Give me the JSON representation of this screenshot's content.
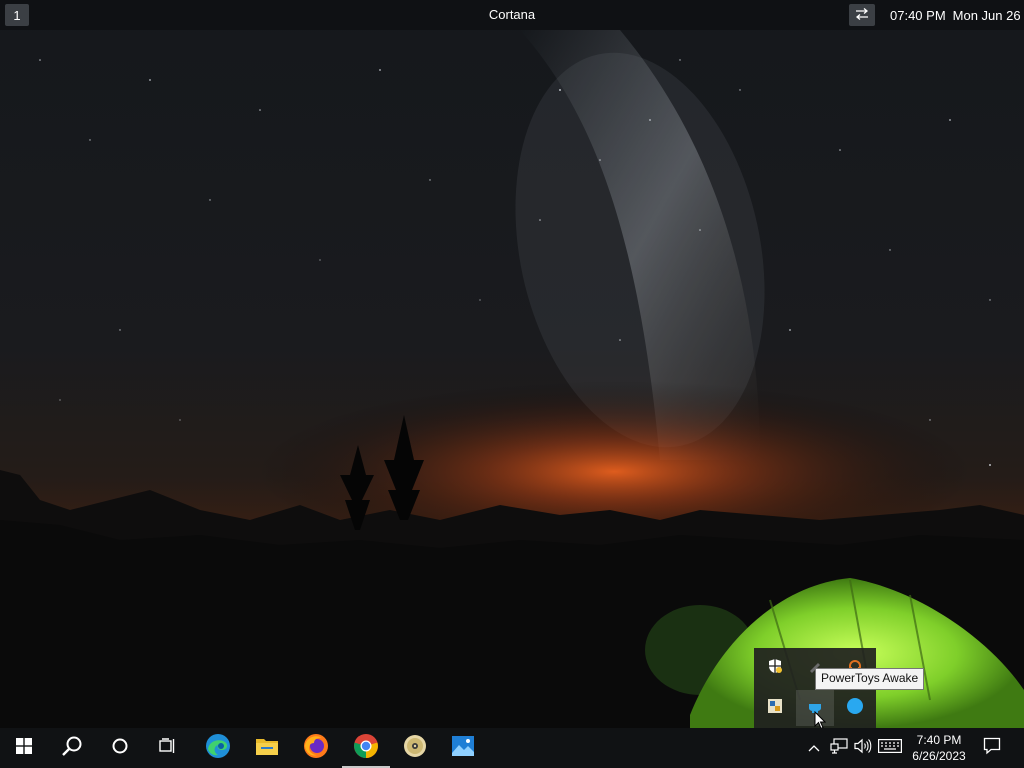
{
  "topbar": {
    "workspace": "1",
    "title": "Cortana",
    "time": "07:40 PM",
    "date": "Mon Jun 26"
  },
  "tray_popup": {
    "tooltip": "PowerToys Awake",
    "icons": [
      "security-shield-icon",
      "pen-icon",
      "headset-icon",
      "app-icon",
      "powertoys-awake-icon",
      "blue-circle-icon"
    ]
  },
  "taskbar": {
    "pinned": [
      "start-icon",
      "search-icon",
      "cortana-icon",
      "task-view-icon",
      "edge-icon",
      "file-explorer-icon",
      "firefox-icon",
      "chrome-icon",
      "disc-icon",
      "photos-icon"
    ],
    "active_app": "chrome-icon",
    "clock_time": "7:40 PM",
    "clock_date": "6/26/2023"
  },
  "colors": {
    "taskbar_bg": "#101214",
    "topbar_bg": "#0f1114",
    "tent_green": "#8fe03a",
    "sky_glow": "#d8561c"
  }
}
